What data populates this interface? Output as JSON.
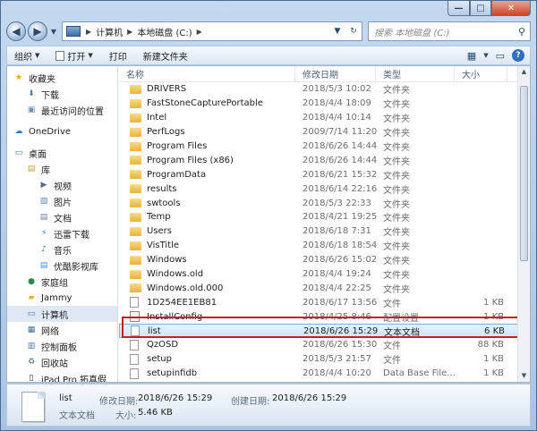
{
  "window": {
    "controls": {
      "minimize": "—",
      "maximize": "□",
      "close": "✕"
    }
  },
  "nav": {
    "back_glyph": "◀",
    "forward_glyph": "▶",
    "address": [
      "计算机",
      "本地磁盘 (C:)"
    ],
    "search_placeholder": "搜索 本地磁盘 (C:)"
  },
  "toolbar": {
    "organize": "组织",
    "open": "打开",
    "print": "打印",
    "new_folder": "新建文件夹"
  },
  "sidebar": [
    {
      "label": "收藏夹",
      "icon": "star-icon",
      "indent": 0
    },
    {
      "label": "下载",
      "icon": "download-folder-icon",
      "indent": 1
    },
    {
      "label": "最近访问的位置",
      "icon": "recent-places-icon",
      "indent": 1
    },
    {
      "label": "OneDrive",
      "icon": "cloud-icon",
      "indent": 0,
      "gap": true
    },
    {
      "label": "桌面",
      "icon": "desktop-icon",
      "indent": 0,
      "gap": true
    },
    {
      "label": "库",
      "icon": "library-icon",
      "indent": 1
    },
    {
      "label": "视频",
      "icon": "video-icon",
      "indent": 2
    },
    {
      "label": "图片",
      "icon": "picture-icon",
      "indent": 2
    },
    {
      "label": "文档",
      "icon": "document-icon",
      "indent": 2
    },
    {
      "label": "迅雷下载",
      "icon": "thunder-download-icon",
      "indent": 2
    },
    {
      "label": "音乐",
      "icon": "music-icon",
      "indent": 2
    },
    {
      "label": "优酷影视库",
      "icon": "youku-library-icon",
      "indent": 2
    },
    {
      "label": "家庭组",
      "icon": "homegroup-icon",
      "indent": 1
    },
    {
      "label": "Jammy",
      "icon": "user-folder-icon",
      "indent": 1
    },
    {
      "label": "计算机",
      "icon": "computer-icon",
      "indent": 1,
      "selected": true
    },
    {
      "label": "网络",
      "icon": "network-icon",
      "indent": 1
    },
    {
      "label": "控制面板",
      "icon": "control-panel-icon",
      "indent": 1
    },
    {
      "label": "回收站",
      "icon": "recycle-bin-icon",
      "indent": 1
    },
    {
      "label": "iPad Pro 拓真假",
      "icon": "ipad-icon",
      "indent": 1
    }
  ],
  "columns": {
    "name": "名称",
    "date": "修改日期",
    "type": "类型",
    "size": "大小"
  },
  "files": [
    {
      "name": "DRIVERS",
      "date": "2018/5/3 10:02",
      "type": "文件夹",
      "size": "",
      "kind": "folder"
    },
    {
      "name": "FastStoneCapturePortable",
      "date": "2018/4/4 18:09",
      "type": "文件夹",
      "size": "",
      "kind": "folder"
    },
    {
      "name": "Intel",
      "date": "2018/4/4 10:14",
      "type": "文件夹",
      "size": "",
      "kind": "folder"
    },
    {
      "name": "PerfLogs",
      "date": "2009/7/14 11:20",
      "type": "文件夹",
      "size": "",
      "kind": "folder"
    },
    {
      "name": "Program Files",
      "date": "2018/6/26 14:44",
      "type": "文件夹",
      "size": "",
      "kind": "folder"
    },
    {
      "name": "Program Files (x86)",
      "date": "2018/6/26 14:44",
      "type": "文件夹",
      "size": "",
      "kind": "folder"
    },
    {
      "name": "ProgramData",
      "date": "2018/6/21 15:32",
      "type": "文件夹",
      "size": "",
      "kind": "folder"
    },
    {
      "name": "results",
      "date": "2018/6/14 22:16",
      "type": "文件夹",
      "size": "",
      "kind": "folder"
    },
    {
      "name": "swtools",
      "date": "2018/5/3 22:33",
      "type": "文件夹",
      "size": "",
      "kind": "folder"
    },
    {
      "name": "Temp",
      "date": "2018/4/21 19:25",
      "type": "文件夹",
      "size": "",
      "kind": "folder"
    },
    {
      "name": "Users",
      "date": "2018/6/18 7:31",
      "type": "文件夹",
      "size": "",
      "kind": "folder"
    },
    {
      "name": "VisTitle",
      "date": "2018/6/18 18:54",
      "type": "文件夹",
      "size": "",
      "kind": "folder"
    },
    {
      "name": "Windows",
      "date": "2018/6/26 15:02",
      "type": "文件夹",
      "size": "",
      "kind": "folder"
    },
    {
      "name": "Windows.old",
      "date": "2018/4/4 19:24",
      "type": "文件夹",
      "size": "",
      "kind": "folder"
    },
    {
      "name": "Windows.old.000",
      "date": "2018/4/4 22:25",
      "type": "文件夹",
      "size": "",
      "kind": "folder"
    },
    {
      "name": "1D254EE1EB81",
      "date": "2018/6/17 13:56",
      "type": "文件",
      "size": "1 KB",
      "kind": "file"
    },
    {
      "name": "InstallConfig",
      "date": "2018/4/25 8:46",
      "type": "配置设置",
      "size": "1 KB",
      "kind": "cfg"
    },
    {
      "name": "list",
      "date": "2018/6/26 15:29",
      "type": "文本文档",
      "size": "6 KB",
      "kind": "file",
      "highlight": true
    },
    {
      "name": "QzOSD",
      "date": "2018/6/26 15:30",
      "type": "文件",
      "size": "88 KB",
      "kind": "file"
    },
    {
      "name": "setup",
      "date": "2018/5/3 21:57",
      "type": "文件",
      "size": "1 KB",
      "kind": "file"
    },
    {
      "name": "setupinfidb",
      "date": "2018/4/4 10:20",
      "type": "Data Base File...",
      "size": "1 KB",
      "kind": "file"
    }
  ],
  "details": {
    "name": "list",
    "kind": "文本文档",
    "modified_label": "修改日期:",
    "modified": "2018/6/26 15:29",
    "created_label": "创建日期:",
    "created": "2018/6/26 15:29",
    "size_label": "大小:",
    "size": "5.46 KB"
  }
}
